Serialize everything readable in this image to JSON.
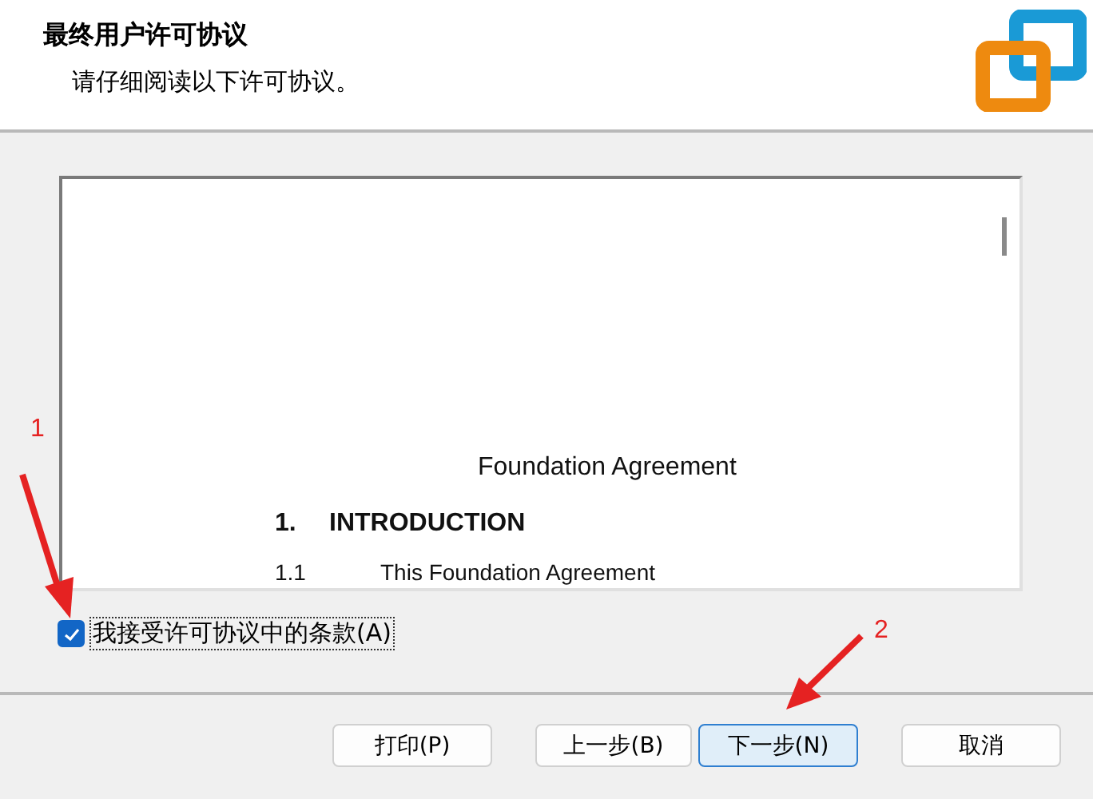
{
  "header": {
    "title": "最终用户许可协议",
    "subtitle": "请仔细阅读以下许可协议。"
  },
  "document": {
    "title": "Foundation Agreement",
    "heading_number": "1.",
    "heading": "INTRODUCTION",
    "clause_number": "1.1",
    "clause": "This Foundation Agreement"
  },
  "accept_checkbox": {
    "label": "我接受许可协议中的条款(A)",
    "checked": true
  },
  "buttons": [
    {
      "label": "打印(P)",
      "default": false
    },
    {
      "label": "上一步(B)",
      "default": false
    },
    {
      "label": "下一步(N)",
      "default": true
    },
    {
      "label": "取消",
      "default": false
    }
  ],
  "annotations": [
    {
      "label": "1"
    },
    {
      "label": "2"
    }
  ]
}
